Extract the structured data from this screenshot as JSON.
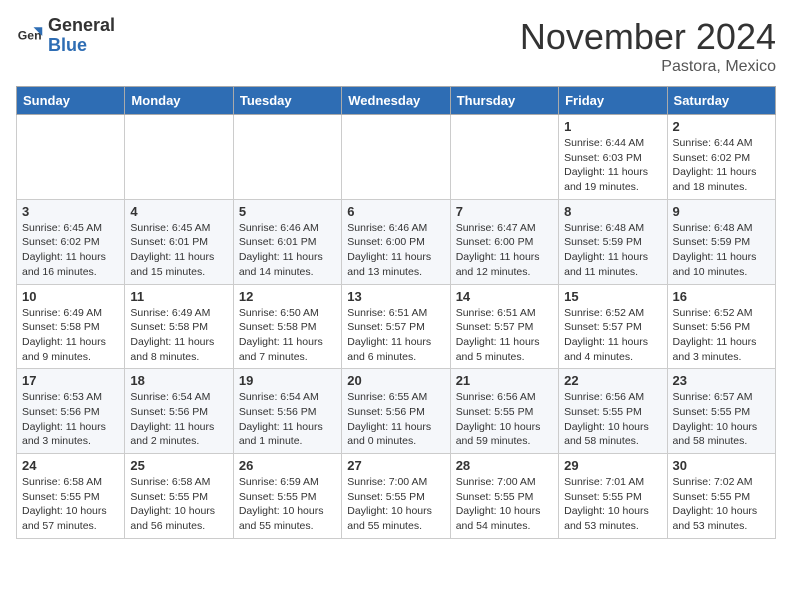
{
  "header": {
    "logo_general": "General",
    "logo_blue": "Blue",
    "month_title": "November 2024",
    "location": "Pastora, Mexico"
  },
  "weekdays": [
    "Sunday",
    "Monday",
    "Tuesday",
    "Wednesday",
    "Thursday",
    "Friday",
    "Saturday"
  ],
  "weeks": [
    [
      {
        "day": "",
        "info": ""
      },
      {
        "day": "",
        "info": ""
      },
      {
        "day": "",
        "info": ""
      },
      {
        "day": "",
        "info": ""
      },
      {
        "day": "",
        "info": ""
      },
      {
        "day": "1",
        "info": "Sunrise: 6:44 AM\nSunset: 6:03 PM\nDaylight: 11 hours and 19 minutes."
      },
      {
        "day": "2",
        "info": "Sunrise: 6:44 AM\nSunset: 6:02 PM\nDaylight: 11 hours and 18 minutes."
      }
    ],
    [
      {
        "day": "3",
        "info": "Sunrise: 6:45 AM\nSunset: 6:02 PM\nDaylight: 11 hours and 16 minutes."
      },
      {
        "day": "4",
        "info": "Sunrise: 6:45 AM\nSunset: 6:01 PM\nDaylight: 11 hours and 15 minutes."
      },
      {
        "day": "5",
        "info": "Sunrise: 6:46 AM\nSunset: 6:01 PM\nDaylight: 11 hours and 14 minutes."
      },
      {
        "day": "6",
        "info": "Sunrise: 6:46 AM\nSunset: 6:00 PM\nDaylight: 11 hours and 13 minutes."
      },
      {
        "day": "7",
        "info": "Sunrise: 6:47 AM\nSunset: 6:00 PM\nDaylight: 11 hours and 12 minutes."
      },
      {
        "day": "8",
        "info": "Sunrise: 6:48 AM\nSunset: 5:59 PM\nDaylight: 11 hours and 11 minutes."
      },
      {
        "day": "9",
        "info": "Sunrise: 6:48 AM\nSunset: 5:59 PM\nDaylight: 11 hours and 10 minutes."
      }
    ],
    [
      {
        "day": "10",
        "info": "Sunrise: 6:49 AM\nSunset: 5:58 PM\nDaylight: 11 hours and 9 minutes."
      },
      {
        "day": "11",
        "info": "Sunrise: 6:49 AM\nSunset: 5:58 PM\nDaylight: 11 hours and 8 minutes."
      },
      {
        "day": "12",
        "info": "Sunrise: 6:50 AM\nSunset: 5:58 PM\nDaylight: 11 hours and 7 minutes."
      },
      {
        "day": "13",
        "info": "Sunrise: 6:51 AM\nSunset: 5:57 PM\nDaylight: 11 hours and 6 minutes."
      },
      {
        "day": "14",
        "info": "Sunrise: 6:51 AM\nSunset: 5:57 PM\nDaylight: 11 hours and 5 minutes."
      },
      {
        "day": "15",
        "info": "Sunrise: 6:52 AM\nSunset: 5:57 PM\nDaylight: 11 hours and 4 minutes."
      },
      {
        "day": "16",
        "info": "Sunrise: 6:52 AM\nSunset: 5:56 PM\nDaylight: 11 hours and 3 minutes."
      }
    ],
    [
      {
        "day": "17",
        "info": "Sunrise: 6:53 AM\nSunset: 5:56 PM\nDaylight: 11 hours and 3 minutes."
      },
      {
        "day": "18",
        "info": "Sunrise: 6:54 AM\nSunset: 5:56 PM\nDaylight: 11 hours and 2 minutes."
      },
      {
        "day": "19",
        "info": "Sunrise: 6:54 AM\nSunset: 5:56 PM\nDaylight: 11 hours and 1 minute."
      },
      {
        "day": "20",
        "info": "Sunrise: 6:55 AM\nSunset: 5:56 PM\nDaylight: 11 hours and 0 minutes."
      },
      {
        "day": "21",
        "info": "Sunrise: 6:56 AM\nSunset: 5:55 PM\nDaylight: 10 hours and 59 minutes."
      },
      {
        "day": "22",
        "info": "Sunrise: 6:56 AM\nSunset: 5:55 PM\nDaylight: 10 hours and 58 minutes."
      },
      {
        "day": "23",
        "info": "Sunrise: 6:57 AM\nSunset: 5:55 PM\nDaylight: 10 hours and 58 minutes."
      }
    ],
    [
      {
        "day": "24",
        "info": "Sunrise: 6:58 AM\nSunset: 5:55 PM\nDaylight: 10 hours and 57 minutes."
      },
      {
        "day": "25",
        "info": "Sunrise: 6:58 AM\nSunset: 5:55 PM\nDaylight: 10 hours and 56 minutes."
      },
      {
        "day": "26",
        "info": "Sunrise: 6:59 AM\nSunset: 5:55 PM\nDaylight: 10 hours and 55 minutes."
      },
      {
        "day": "27",
        "info": "Sunrise: 7:00 AM\nSunset: 5:55 PM\nDaylight: 10 hours and 55 minutes."
      },
      {
        "day": "28",
        "info": "Sunrise: 7:00 AM\nSunset: 5:55 PM\nDaylight: 10 hours and 54 minutes."
      },
      {
        "day": "29",
        "info": "Sunrise: 7:01 AM\nSunset: 5:55 PM\nDaylight: 10 hours and 53 minutes."
      },
      {
        "day": "30",
        "info": "Sunrise: 7:02 AM\nSunset: 5:55 PM\nDaylight: 10 hours and 53 minutes."
      }
    ]
  ]
}
